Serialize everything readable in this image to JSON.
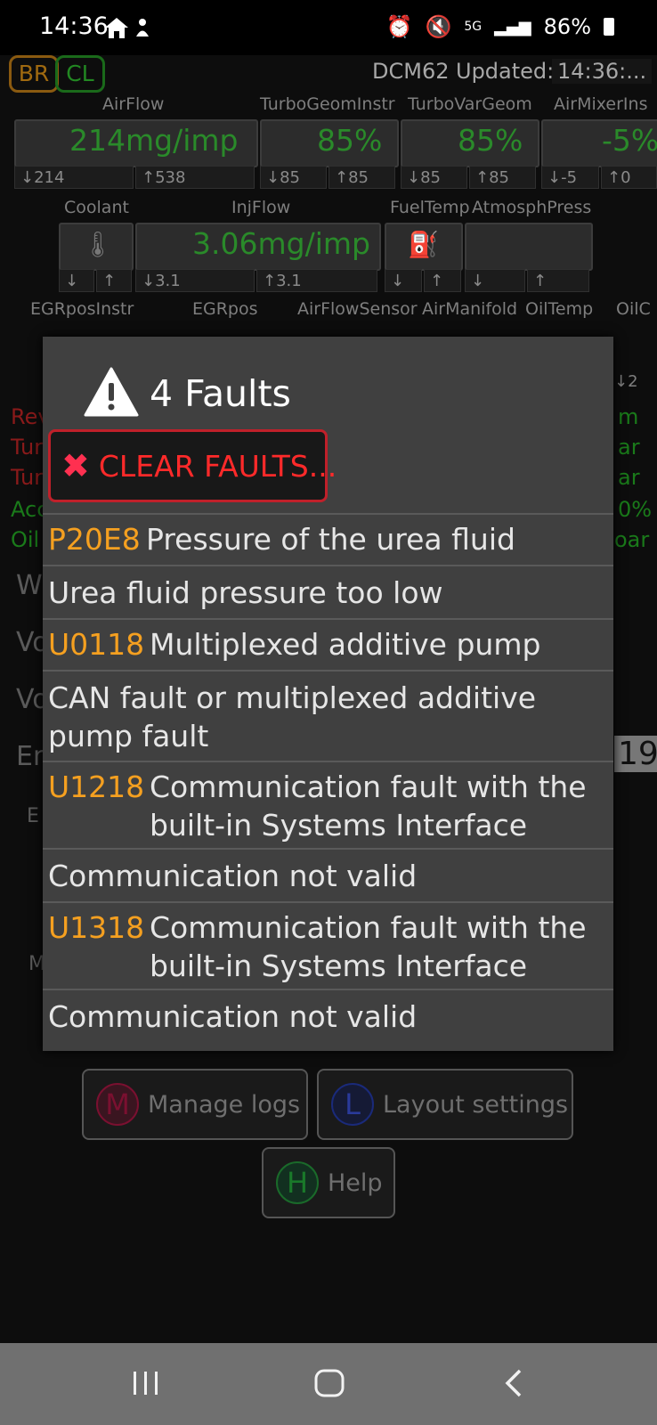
{
  "status_bar": {
    "time": "14:36",
    "battery": "86%",
    "network": "5G"
  },
  "header": {
    "chip_br": "BR",
    "chip_cl": "CL",
    "device": "DCM62",
    "updated_label": "Updated:",
    "updated_time": "14:36:..."
  },
  "row1": {
    "labels": [
      "AirFlow",
      "TurboGeomInstr",
      "TurboVarGeom",
      "AirMixerIns"
    ],
    "values": [
      "214mg/imp",
      "85%",
      "85%",
      "-5%"
    ],
    "minmax": [
      "↓214",
      "↑538",
      "↓85",
      "↑85",
      "↓85",
      "↑85",
      "↓-5",
      "↑0"
    ]
  },
  "row2": {
    "labels": [
      "Coolant",
      "InjFlow",
      "FuelTemp",
      "AtmosphPress"
    ],
    "value": "3.06mg/imp",
    "minmax": [
      "↓",
      "↑",
      "↓3.1",
      "↑3.1",
      "↓",
      "↑",
      "↓",
      "↑"
    ]
  },
  "row3": {
    "labels": [
      "EGRposInstr",
      "EGRpos",
      "AirFlowSensor",
      "AirManifold",
      "OilTemp",
      "OilC"
    ],
    "right_min": "↓2"
  },
  "left_edge": [
    "Rev",
    "Tur",
    "Tur",
    "Acc",
    "Oil"
  ],
  "right_edge": [
    "m",
    "ar",
    "ar",
    "0%",
    "oar"
  ],
  "left_boxes": [
    "W",
    "Vo",
    "Vo",
    "En",
    "E",
    "M"
  ],
  "right_number": "19",
  "buttons": {
    "manage_logs": "Manage logs",
    "manage_logs_letter": "M",
    "layout_settings": "Layout settings",
    "layout_letter": "L",
    "help": "Help",
    "help_letter": "H"
  },
  "dialog": {
    "title": "4 Faults",
    "clear_label": "CLEAR FAULTS...",
    "faults": [
      {
        "code": "P20E8",
        "description": "Pressure of the urea fluid",
        "detail": "Urea fluid pressure too low"
      },
      {
        "code": "U0118",
        "description": "Multiplexed additive pump",
        "detail": "CAN fault or multiplexed additive pump fault"
      },
      {
        "code": "U1218",
        "description": "Communication fault with the built-in Systems Interface",
        "detail": "Communication not valid"
      },
      {
        "code": "U1318",
        "description": "Communication fault with the built-in Systems Interface",
        "detail": "Communication not valid"
      }
    ]
  },
  "colors": {
    "value_green": "#2a8a2a",
    "code_orange": "#f5a020",
    "clear_red": "#ff2a2a"
  }
}
